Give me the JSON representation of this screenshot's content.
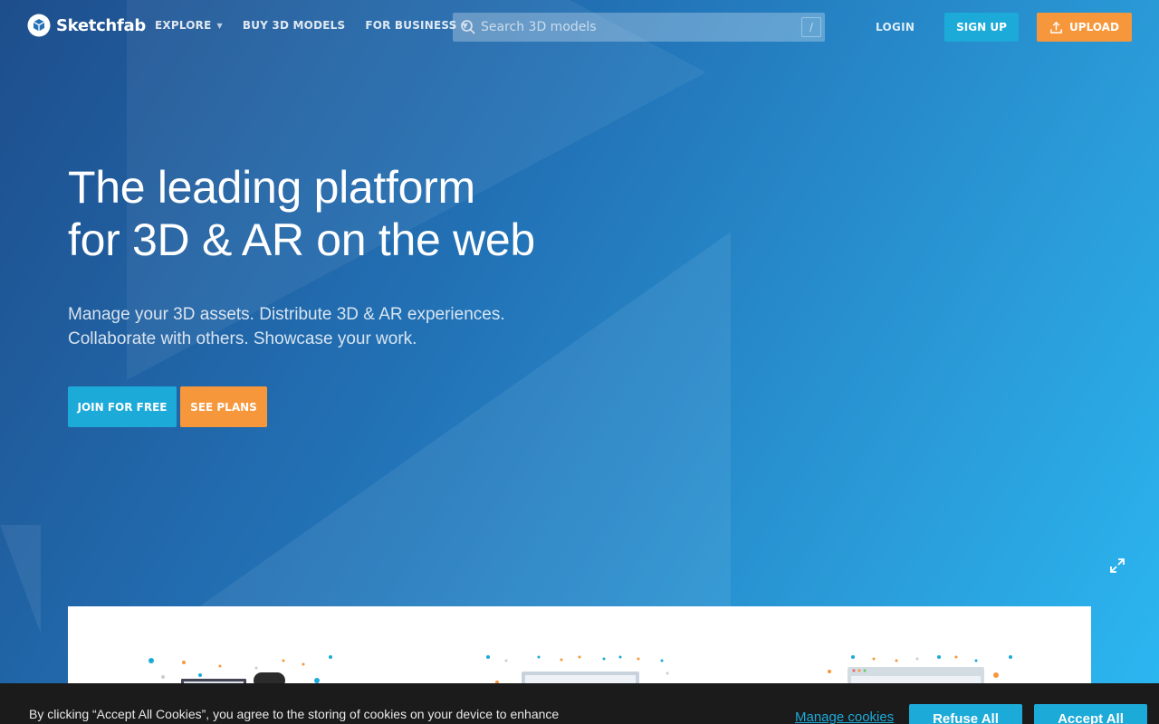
{
  "brand": {
    "name": "Sketchfab",
    "accent_blue": "#1caad9",
    "accent_orange": "#f7973c"
  },
  "header": {
    "nav": [
      {
        "label": "EXPLORE",
        "has_dropdown": true
      },
      {
        "label": "BUY 3D MODELS",
        "has_dropdown": false
      },
      {
        "label": "FOR BUSINESS",
        "has_dropdown": true
      }
    ],
    "search": {
      "placeholder": "Search 3D models",
      "shortcut": "/"
    },
    "login_label": "LOGIN",
    "signup_label": "SIGN UP",
    "upload_label": "UPLOAD"
  },
  "hero": {
    "headline_line1": "The leading platform",
    "headline_line2": "for 3D & AR on the web",
    "sub_line1": "Manage your 3D assets. Distribute 3D & AR experiences.",
    "sub_line2": "Collaborate with others. Showcase your work.",
    "join_label": "JOIN FOR FREE",
    "plans_label": "SEE PLANS"
  },
  "icons": {
    "logo": "sketchfab-logo-icon",
    "search": "search-icon",
    "upload": "upload-icon",
    "expand": "expand-icon",
    "caret": "caret-down-icon"
  },
  "cookie_banner": {
    "text_line1": "By clicking “Accept All Cookies”, you agree to the storing of cookies on your device to enhance site",
    "manage_label": "Manage cookies",
    "refuse_label": "Refuse All",
    "accept_label": "Accept All"
  }
}
